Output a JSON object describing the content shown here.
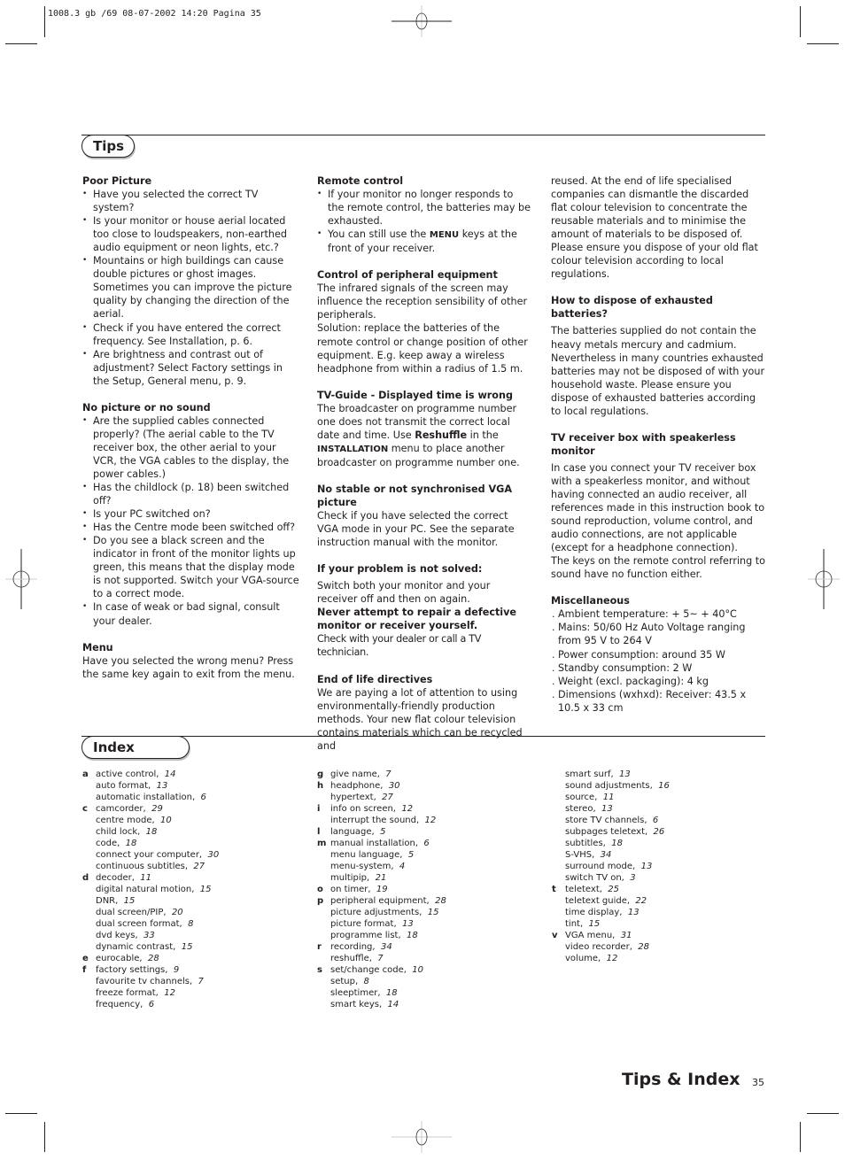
{
  "slug": "1008.3 gb /69 08-07-2002 14:20 Pagina 35",
  "tips": {
    "heading": "Tips",
    "col1": [
      {
        "title": "Poor Picture",
        "bullets": [
          "Have you selected the correct TV system?",
          "Is your monitor or house aerial located too close to loudspeakers, non-earthed audio equipment or neon lights, etc.?",
          "Mountains or high buildings can cause double pictures or ghost images. Sometimes you can improve the picture quality by changing the direction of the aerial.",
          "Check if you have entered the correct frequency. See Installation, p. 6.",
          "Are brightness and contrast out of adjustment? Select Factory settings in the Setup, General menu, p. 9."
        ]
      },
      {
        "title": "No picture or no sound",
        "bullets": [
          "Are the supplied cables connected properly? (The aerial cable to the TV receiver box, the other aerial to your VCR, the VGA cables to the display, the power cables.)",
          "Has the childlock (p. 18) been switched off?",
          "Is your PC switched on?",
          "Has the Centre mode been switched off?",
          "Do you see a black screen and the indicator in front of the monitor lights up green, this means that the display mode is not supported. Switch your VGA-source to a correct mode.",
          "In case of weak or bad signal, consult your dealer."
        ]
      },
      {
        "title": "Menu",
        "text": "Have you selected the wrong menu? Press the same key again to exit from the menu."
      }
    ],
    "col2": {
      "remote_title": "Remote control",
      "remote_b1": "If your monitor no longer responds to the remote control, the batteries may be exhausted.",
      "remote_b2_pre": "You can still use the ",
      "remote_b2_key": "MENU",
      "remote_b2_post": " keys at the front of your receiver.",
      "periph_title": "Control of peripheral equipment",
      "periph_text1": "The infrared signals of the screen may influence the reception sensibility of other peripherals.",
      "periph_text2": "Solution: replace the batteries of the remote control or change position of other equipment. E.g. keep away a wireless headphone from within a radius of 1.5 m.",
      "guide_title": "TV-Guide - Displayed time is wrong",
      "guide_pre": "The broadcaster on programme number one does not transmit the correct local date and time. Use ",
      "guide_bold": "Reshuffle",
      "guide_mid": " in the ",
      "guide_key": "INSTALLATION",
      "guide_post": " menu to place another broadcaster on programme number one.",
      "vga_title": "No stable or not synchronised VGA picture",
      "vga_text": "Check if you have selected the correct VGA mode in your PC. See the separate instruction manual with the monitor.",
      "solve_title": "If your problem is not solved:",
      "solve_text": "Switch both your monitor and your receiver off and then on again.",
      "never_title": "Never attempt to repair a defective monitor or receiver yourself.",
      "never_text": "Check with your dealer or call a TV technician.",
      "eol_title": "End of life directives",
      "eol_text": "We are paying a lot of attention to using environmentally-friendly production methods. Your new flat colour television contains materials which can be recycled and"
    },
    "col3": {
      "eol_cont": "reused.  At the end of life specialised companies can dismantle the discarded flat colour television to concentrate the reusable materials and to minimise the amount of materials to be disposed of. Please ensure you dispose of your old flat colour television according to local regulations.",
      "batt_title": "How to dispose of exhausted batteries?",
      "batt_text": "The batteries supplied do not contain the heavy metals mercury and cadmium. Nevertheless in many countries exhausted batteries may not be disposed of with your household waste. Please ensure you dispose of exhausted batteries according to local regulations.",
      "recv_title": "TV receiver box with speakerless monitor",
      "recv_text1": "In case you connect your TV receiver box with a speakerless monitor, and without having connected an audio receiver, all references made in this instruction book to sound reproduction, volume control, and audio connections, are not applicable (except for a headphone connection).",
      "recv_text2": "The keys on the remote control referring to sound have no function either.",
      "misc_title": "Miscellaneous",
      "misc": [
        "Ambient temperature: + 5~ + 40°C",
        "Mains: 50/60 Hz Auto Voltage ranging from 95 V to 264 V",
        "Power consumption: around 35 W",
        "Standby consumption: 2 W",
        "Weight (excl. packaging): 4 kg",
        "Dimensions (wxhxd): Receiver: 43.5 x 10.5 x 33 cm"
      ]
    }
  },
  "index": {
    "heading": "Index",
    "columns": [
      [
        {
          "letter": "a",
          "term": "active control,",
          "page": "14"
        },
        {
          "letter": "",
          "term": "auto format,",
          "page": "13"
        },
        {
          "letter": "",
          "term": "automatic installation,",
          "page": "6"
        },
        {
          "letter": "c",
          "term": "camcorder,",
          "page": "29"
        },
        {
          "letter": "",
          "term": "centre mode,",
          "page": "10"
        },
        {
          "letter": "",
          "term": "child lock,",
          "page": "18"
        },
        {
          "letter": "",
          "term": "code,",
          "page": "18"
        },
        {
          "letter": "",
          "term": "connect your computer,",
          "page": "30"
        },
        {
          "letter": "",
          "term": "continuous subtitles,",
          "page": "27"
        },
        {
          "letter": "d",
          "term": "decoder,",
          "page": "11"
        },
        {
          "letter": "",
          "term": "digital natural motion,",
          "page": "15"
        },
        {
          "letter": "",
          "term": "DNR,",
          "page": "15"
        },
        {
          "letter": "",
          "term": "dual screen/PIP,",
          "page": "20"
        },
        {
          "letter": "",
          "term": "dual screen format,",
          "page": "8"
        },
        {
          "letter": "",
          "term": "dvd keys,",
          "page": "33"
        },
        {
          "letter": "",
          "term": "dynamic contrast,",
          "page": "15"
        },
        {
          "letter": "e",
          "term": "eurocable,",
          "page": "28"
        },
        {
          "letter": "f",
          "term": "factory settings,",
          "page": "9"
        },
        {
          "letter": "",
          "term": "favourite tv channels,",
          "page": "7"
        },
        {
          "letter": "",
          "term": "freeze format,",
          "page": "12"
        },
        {
          "letter": "",
          "term": "frequency,",
          "page": "6"
        }
      ],
      [
        {
          "letter": "g",
          "term": "give name,",
          "page": "7"
        },
        {
          "letter": "h",
          "term": "headphone,",
          "page": "30"
        },
        {
          "letter": "",
          "term": "hypertext,",
          "page": "27"
        },
        {
          "letter": "i",
          "term": "info on screen,",
          "page": "12"
        },
        {
          "letter": "",
          "term": "interrupt the sound,",
          "page": "12"
        },
        {
          "letter": "l",
          "term": "language,",
          "page": "5"
        },
        {
          "letter": "m",
          "term": "manual installation,",
          "page": "6"
        },
        {
          "letter": "",
          "term": "menu language,",
          "page": "5"
        },
        {
          "letter": "",
          "term": "menu-system,",
          "page": "4"
        },
        {
          "letter": "",
          "term": "multipip,",
          "page": "21"
        },
        {
          "letter": "o",
          "term": "on timer,",
          "page": "19"
        },
        {
          "letter": "p",
          "term": "peripheral equipment,",
          "page": "28"
        },
        {
          "letter": "",
          "term": "picture adjustments,",
          "page": "15"
        },
        {
          "letter": "",
          "term": "picture format,",
          "page": "13"
        },
        {
          "letter": "",
          "term": "programme list,",
          "page": "18"
        },
        {
          "letter": "r",
          "term": "recording,",
          "page": "34"
        },
        {
          "letter": "",
          "term": "reshuffle,",
          "page": "7"
        },
        {
          "letter": "s",
          "term": "set/change code,",
          "page": "10"
        },
        {
          "letter": "",
          "term": "setup,",
          "page": "8"
        },
        {
          "letter": "",
          "term": "sleeptimer,",
          "page": "18"
        },
        {
          "letter": "",
          "term": "smart keys,",
          "page": "14"
        }
      ],
      [
        {
          "letter": "",
          "term": "smart surf,",
          "page": "13"
        },
        {
          "letter": "",
          "term": "sound adjustments,",
          "page": "16"
        },
        {
          "letter": "",
          "term": "source,",
          "page": "11"
        },
        {
          "letter": "",
          "term": "stereo,",
          "page": "13"
        },
        {
          "letter": "",
          "term": "store TV channels,",
          "page": "6"
        },
        {
          "letter": "",
          "term": "subpages teletext,",
          "page": "26"
        },
        {
          "letter": "",
          "term": "subtitles,",
          "page": "18"
        },
        {
          "letter": "",
          "term": "S-VHS,",
          "page": "34"
        },
        {
          "letter": "",
          "term": "surround mode,",
          "page": "13"
        },
        {
          "letter": "",
          "term": "switch TV on,",
          "page": "3"
        },
        {
          "letter": "t",
          "term": "teletext,",
          "page": "25"
        },
        {
          "letter": "",
          "term": "teletext guide,",
          "page": "22"
        },
        {
          "letter": "",
          "term": "time display,",
          "page": "13"
        },
        {
          "letter": "",
          "term": "tint,",
          "page": "15"
        },
        {
          "letter": "v",
          "term": "VGA menu,",
          "page": "31"
        },
        {
          "letter": "",
          "term": "video recorder,",
          "page": "28"
        },
        {
          "letter": "",
          "term": "volume,",
          "page": "12"
        }
      ]
    ]
  },
  "footer": {
    "title": "Tips & Index",
    "page_number": "35"
  }
}
